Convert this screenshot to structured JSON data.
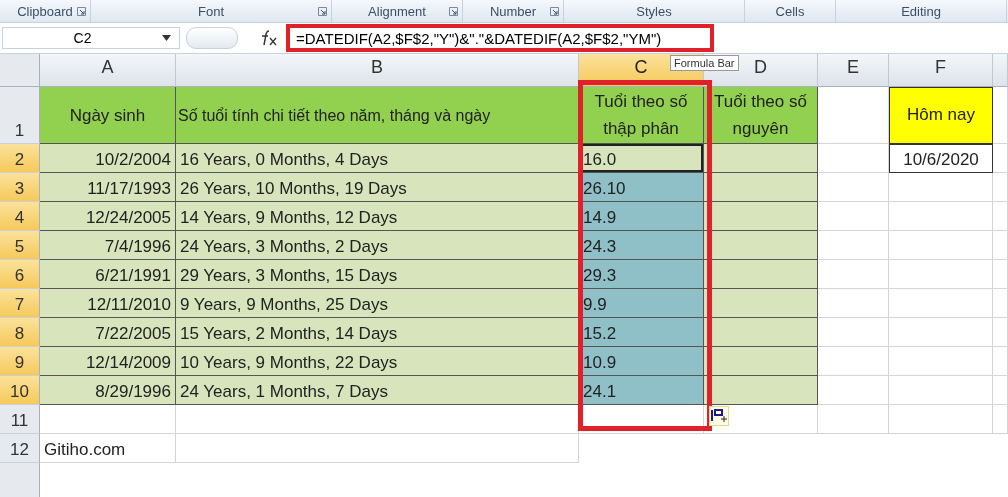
{
  "ribbon_groups": [
    {
      "label": "Clipboard",
      "launcher": true
    },
    {
      "label": "Font",
      "launcher": true
    },
    {
      "label": "Alignment",
      "launcher": true
    },
    {
      "label": "Number",
      "launcher": true
    },
    {
      "label": "Styles",
      "launcher": false
    },
    {
      "label": "Cells",
      "launcher": false
    },
    {
      "label": "Editing",
      "launcher": false
    }
  ],
  "name_box": {
    "value": "C2"
  },
  "formula_bar": {
    "value": "=DATEDIF(A2,$F$2,\"Y\")&\".\"&DATEDIF(A2,$F$2,\"YM\")",
    "tooltip": "Formula Bar"
  },
  "columns": [
    {
      "label": "A",
      "selected": false
    },
    {
      "label": "B",
      "selected": false
    },
    {
      "label": "C",
      "selected": true
    },
    {
      "label": "D",
      "selected": false
    },
    {
      "label": "E",
      "selected": false
    },
    {
      "label": "F",
      "selected": false
    }
  ],
  "header_row": {
    "number": "1",
    "cells": [
      "Ngày sinh",
      "Số tuổi tính chi tiết theo năm, tháng và ngày",
      "Tuổi theo số thập phân",
      "Tuổi theo số nguyên"
    ]
  },
  "today": {
    "label": "Hôm nay",
    "value": "10/6/2020"
  },
  "rows": [
    {
      "kind": "data",
      "number": "2",
      "selected": true,
      "active": true,
      "birth_date": "10/2/2004",
      "age_detail": "16 Years, 0 Months, 4 Days",
      "age_decimal": "16.0"
    },
    {
      "kind": "data",
      "number": "3",
      "selected": true,
      "active": false,
      "birth_date": "11/17/1993",
      "age_detail": "26 Years, 10 Months, 19 Days",
      "age_decimal": "26.10"
    },
    {
      "kind": "data",
      "number": "4",
      "selected": true,
      "active": false,
      "birth_date": "12/24/2005",
      "age_detail": "14 Years, 9 Months, 12 Days",
      "age_decimal": "14.9"
    },
    {
      "kind": "data",
      "number": "5",
      "selected": true,
      "active": false,
      "birth_date": "7/4/1996",
      "age_detail": "24 Years, 3 Months, 2 Days",
      "age_decimal": "24.3"
    },
    {
      "kind": "data",
      "number": "6",
      "selected": true,
      "active": false,
      "birth_date": "6/21/1991",
      "age_detail": "29 Years, 3 Months, 15 Days",
      "age_decimal": "29.3"
    },
    {
      "kind": "data",
      "number": "7",
      "selected": true,
      "active": false,
      "birth_date": "12/11/2010",
      "age_detail": "9 Years, 9 Months, 25 Days",
      "age_decimal": "9.9"
    },
    {
      "kind": "data",
      "number": "8",
      "selected": true,
      "active": false,
      "birth_date": "7/22/2005",
      "age_detail": "15 Years, 2 Months, 14 Days",
      "age_decimal": "15.2"
    },
    {
      "kind": "data",
      "number": "9",
      "selected": true,
      "active": false,
      "birth_date": "12/14/2009",
      "age_detail": "10 Years, 9 Months, 22 Days",
      "age_decimal": "10.9"
    },
    {
      "kind": "data",
      "number": "10",
      "selected": true,
      "active": false,
      "birth_date": "8/29/1996",
      "age_detail": "24 Years, 1 Months, 7 Days",
      "age_decimal": "24.1"
    },
    {
      "kind": "blank",
      "number": "11",
      "selected": false
    },
    {
      "kind": "note",
      "number": "12",
      "selected": false,
      "note": "Gitiho.com"
    }
  ]
}
